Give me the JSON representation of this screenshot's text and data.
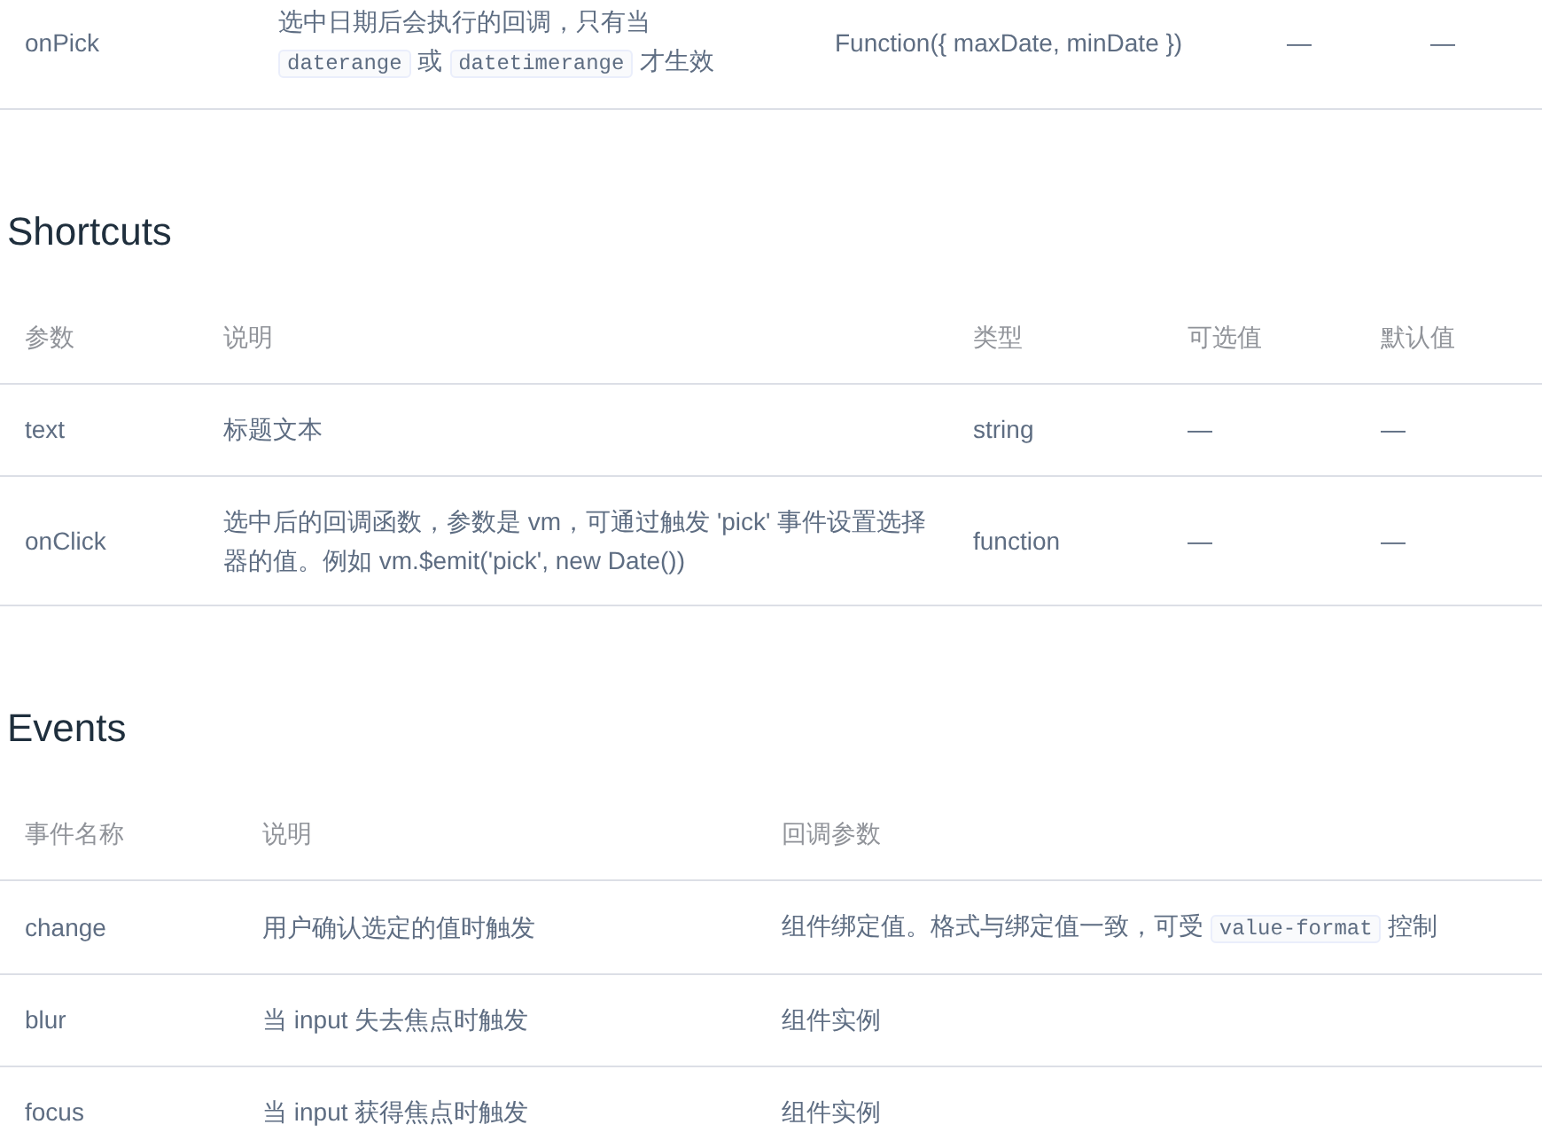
{
  "sections": [
    {
      "rows": [
        [
          "onPick",
          {
            "segments": [
              {
                "kind": "text",
                "text": "选中日期后会执行的回调，只有当 "
              },
              {
                "kind": "code",
                "text": "daterange"
              },
              {
                "kind": "text",
                "text": " 或 "
              },
              {
                "kind": "code",
                "text": "datetimerange"
              },
              {
                "kind": "text",
                "text": " 才生效"
              }
            ]
          },
          "Function({ maxDate, minDate })",
          "—",
          "—"
        ]
      ]
    },
    {
      "heading": "Shortcuts",
      "columns": [
        "参数",
        "说明",
        "类型",
        "可选值",
        "默认值"
      ],
      "rows": [
        [
          "text",
          "标题文本",
          "string",
          "—",
          "—"
        ],
        [
          "onClick",
          "选中后的回调函数，参数是 vm，可通过触发 'pick' 事件设置选择器的值。例如 vm.$emit('pick', new Date())",
          "function",
          "—",
          "—"
        ]
      ]
    },
    {
      "heading": "Events",
      "columns": [
        "事件名称",
        "说明",
        "回调参数"
      ],
      "rows": [
        [
          "change",
          "用户确认选定的值时触发",
          {
            "segments": [
              {
                "kind": "text",
                "text": "组件绑定值。格式与绑定值一致，可受 "
              },
              {
                "kind": "code",
                "text": "value-format"
              },
              {
                "kind": "text",
                "text": " 控制"
              }
            ]
          }
        ],
        [
          "blur",
          "当 input 失去焦点时触发",
          "组件实例"
        ],
        [
          "focus",
          "当 input 获得焦点时触发",
          "组件实例"
        ]
      ]
    }
  ]
}
